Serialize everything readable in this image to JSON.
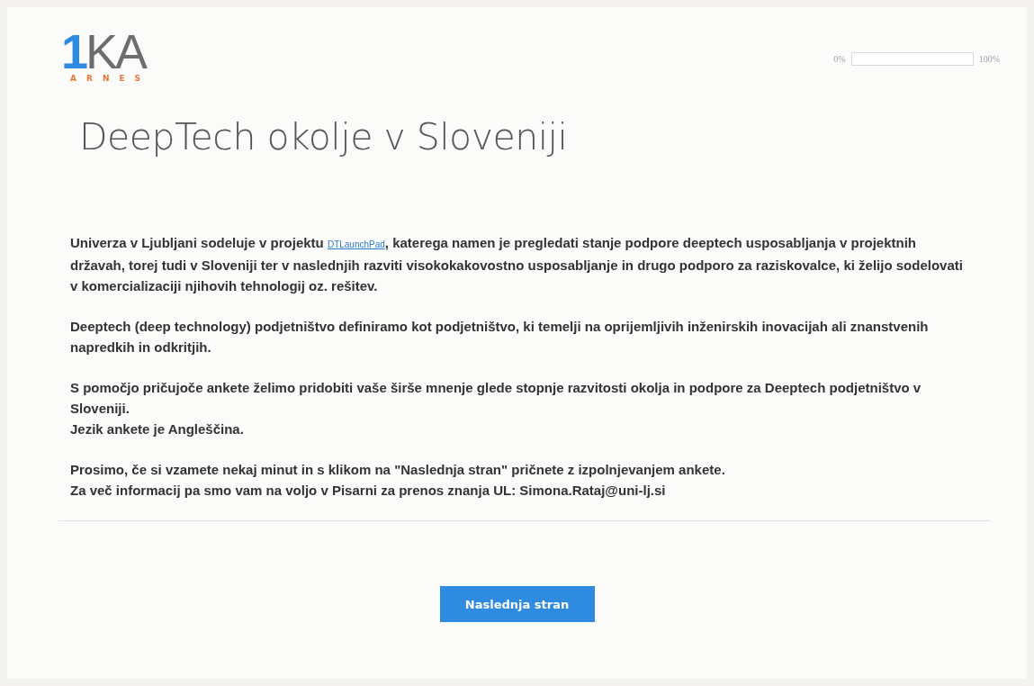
{
  "logo": {
    "mark": "1",
    "letters": "KA",
    "subtitle": "ARNES"
  },
  "progress": {
    "start_label": "0%",
    "level": 0,
    "end_label": "100%"
  },
  "title": "DeepTech okolje v Sloveniji",
  "intro": {
    "before": "Univerza v Ljubljani sodeluje v projektu",
    "link": "DTLaunchPad",
    "after": ", katerega namen je pregledati stanje podpore deeptech usposabljanja v projektnih državah, torej tudi v Sloveniji ter v naslednjih razviti visokokakovostno usposabljanje in drugo podporo za raziskovalce, ki želijo sodelovati v komercializaciji njihovih tehnologij oz. rešitev."
  },
  "paragraphs": [
    [
      "Deeptech (deep technology) podjetništvo definiramo kot podjetništvo, ki temelji na oprijemljivih inženirskih inovacijah ali znanstvenih napredkih in odkritjih."
    ],
    [
      "S pomočjo pričujoče ankete želimo pridobiti vaše širše mnenje glede stopnje razvitosti okolja in podpore za Deeptech podjetništvo v Sloveniji.",
      "Jezik ankete je Angleščina."
    ],
    [
      "Prosimo, če si vzamete nekaj minut in s klikom na \"Naslednja stran\" pričnete z izpolnjevanjem ankete.",
      "Za več informacij pa smo vam na voljo v Pisarni za prenos znanja UL: Simona.Rataj@uni-lj.si"
    ]
  ],
  "next_button": "Naslednja stran"
}
